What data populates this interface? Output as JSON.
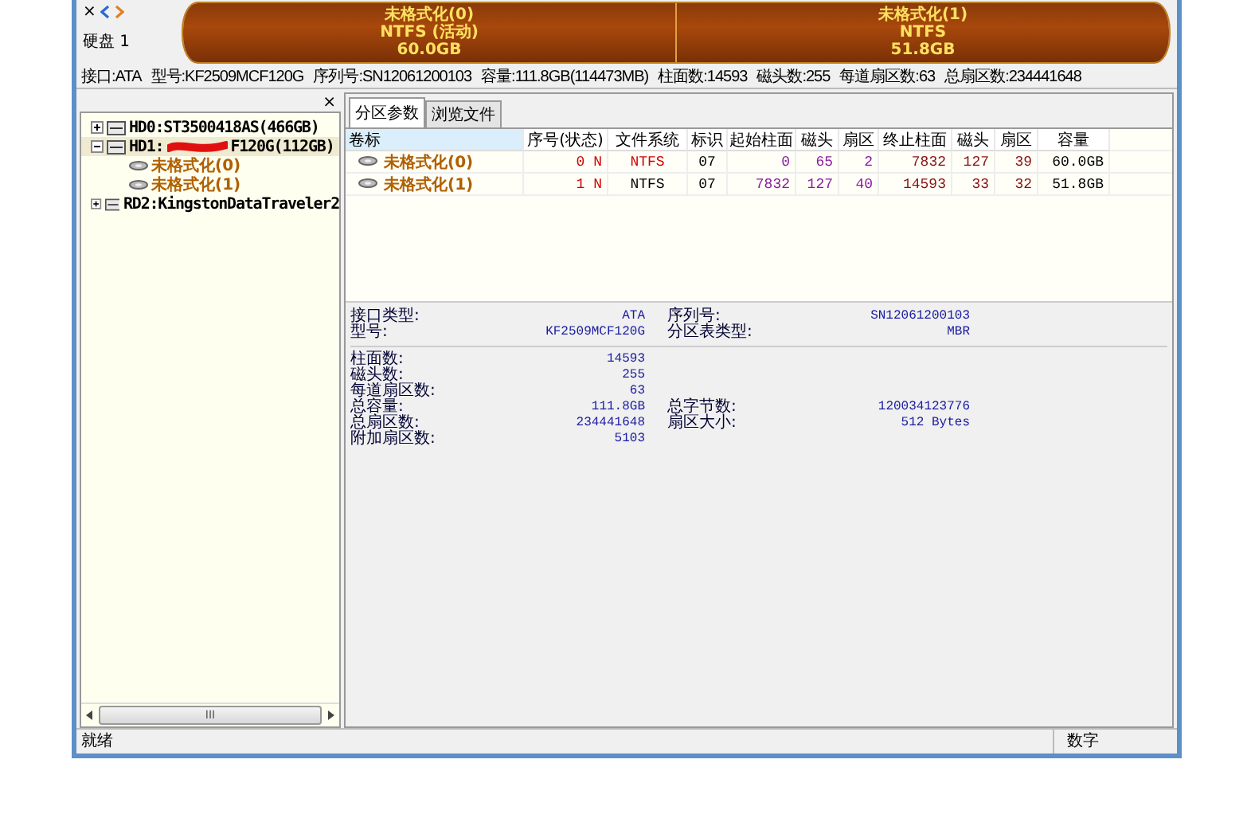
{
  "disk_bar": {
    "close": "×",
    "label": "硬盘 1",
    "partitions": [
      {
        "name": "未格式化(0)",
        "fs": "NTFS (活动)",
        "size": "60.0GB"
      },
      {
        "name": "未格式化(1)",
        "fs": "NTFS",
        "size": "51.8GB"
      }
    ]
  },
  "disk_info": [
    "接口:ATA",
    "型号:KF2509MCF120G",
    "序列号:SN12061200103",
    "容量:111.8GB(114473MB)",
    "柱面数:14593",
    "磁头数:255",
    "每道扇区数:63",
    "总扇区数:234441648"
  ],
  "tree": {
    "close": "×",
    "items": [
      {
        "label": "HD0:ST3500418AS(466GB)",
        "expanded": false,
        "selected": false
      },
      {
        "label": "HD1:",
        "label_after_redaction": "F120G(112GB)",
        "expanded": true,
        "selected": true,
        "children": [
          {
            "label": "未格式化(0)",
            "selected": false
          },
          {
            "label": "未格式化(1)",
            "selected": false
          }
        ]
      },
      {
        "label": "RD2:KingstonDataTraveler2",
        "expanded": false,
        "selected": false
      }
    ],
    "scroll_grip": "III"
  },
  "tabs": [
    {
      "label": "分区参数",
      "selected": true
    },
    {
      "label": "浏览文件",
      "selected": false
    }
  ],
  "table": {
    "columns": [
      "卷标",
      "序号(状态)",
      "文件系统",
      "标识",
      "起始柱面",
      "磁头",
      "扇区",
      "终止柱面",
      "磁头",
      "扇区",
      "容量"
    ],
    "rows": [
      {
        "active": true,
        "cells": [
          "未格式化(0)",
          "0 N",
          "NTFS",
          "07",
          "0",
          "65",
          "2",
          "7832",
          "127",
          "39",
          "60.0GB"
        ]
      },
      {
        "active": false,
        "cells": [
          "未格式化(1)",
          "1 N",
          "NTFS",
          "07",
          "7832",
          "127",
          "40",
          "14593",
          "33",
          "32",
          "51.8GB"
        ]
      }
    ]
  },
  "details": {
    "groups": [
      [
        {
          "label": "接口类型:",
          "value": "ATA",
          "label_2": "序列号:",
          "value_2": "SN12061200103"
        },
        {
          "label": "型号:",
          "value": "KF2509MCF120G",
          "label_2": "分区表类型:",
          "value_2": "MBR"
        }
      ],
      [
        {
          "label": "柱面数:",
          "value": "14593"
        },
        {
          "label": "磁头数:",
          "value": "255"
        },
        {
          "label": "每道扇区数:",
          "value": "63"
        },
        {
          "label": "总容量:",
          "value": "111.8GB",
          "label_2": "总字节数:",
          "value_2": "120034123776"
        },
        {
          "label": "总扇区数:",
          "value": "234441648",
          "label_2": "扇区大小:",
          "value_2": "512 Bytes"
        },
        {
          "label": "附加扇区数:",
          "value": "5103"
        }
      ]
    ]
  },
  "status_bar": {
    "status": "就绪",
    "numlock": "数字"
  }
}
